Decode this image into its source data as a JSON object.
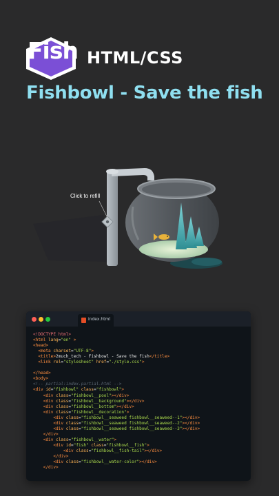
{
  "header": {
    "logo_text": "Fish",
    "logo_subtitle": "HTML/CSS",
    "headline": "Fishbowl - Save the fish"
  },
  "illustration": {
    "refill_label": "Click to refill"
  },
  "editor": {
    "tab_name": "index.html",
    "lines": [
      [
        [
          "doc",
          "<!DOCTYPE html>"
        ]
      ],
      [
        [
          "tag",
          "<html "
        ],
        [
          "attr",
          "lang"
        ],
        [
          "pun",
          "="
        ],
        [
          "str",
          "\"en\""
        ],
        [
          "tag",
          " >"
        ]
      ],
      [
        [
          "tag",
          "<head>"
        ]
      ],
      [
        [
          "pun",
          "  "
        ],
        [
          "tag",
          "<meta "
        ],
        [
          "attr",
          "charset"
        ],
        [
          "pun",
          "="
        ],
        [
          "str",
          "\"UTF-8\""
        ],
        [
          "tag",
          ">"
        ]
      ],
      [
        [
          "pun",
          "  "
        ],
        [
          "tag",
          "<title>"
        ],
        [
          "pun",
          "2much_tech - Fishbowl - Save the fish"
        ],
        [
          "tag",
          "</title>"
        ]
      ],
      [
        [
          "pun",
          "  "
        ],
        [
          "tag",
          "<link "
        ],
        [
          "attr",
          "rel"
        ],
        [
          "pun",
          "="
        ],
        [
          "str",
          "\"stylesheet\""
        ],
        [
          "pun",
          " "
        ],
        [
          "attr",
          "href"
        ],
        [
          "pun",
          "="
        ],
        [
          "str",
          "\"./style.css\""
        ],
        [
          "tag",
          ">"
        ]
      ],
      [
        [
          "pun",
          ""
        ]
      ],
      [
        [
          "tag",
          "</head>"
        ]
      ],
      [
        [
          "tag",
          "<body>"
        ]
      ],
      [
        [
          "cmt",
          "<!-- partial:index.partial.html -->"
        ]
      ],
      [
        [
          "tag",
          "<div "
        ],
        [
          "attr",
          "id"
        ],
        [
          "pun",
          "="
        ],
        [
          "str",
          "\"fishbowl\""
        ],
        [
          "pun",
          " "
        ],
        [
          "attr",
          "class"
        ],
        [
          "pun",
          "="
        ],
        [
          "str",
          "\"fishbowl\""
        ],
        [
          "tag",
          ">"
        ]
      ],
      [
        [
          "pun",
          "    "
        ],
        [
          "tag",
          "<div "
        ],
        [
          "attr",
          "class"
        ],
        [
          "pun",
          "="
        ],
        [
          "str",
          "\"fishbowl__pool\""
        ],
        [
          "tag",
          "></div>"
        ]
      ],
      [
        [
          "pun",
          "    "
        ],
        [
          "tag",
          "<div "
        ],
        [
          "attr",
          "class"
        ],
        [
          "pun",
          "="
        ],
        [
          "str",
          "\"fishbowl__background\""
        ],
        [
          "tag",
          "></div>"
        ]
      ],
      [
        [
          "pun",
          "    "
        ],
        [
          "tag",
          "<div "
        ],
        [
          "attr",
          "class"
        ],
        [
          "pun",
          "="
        ],
        [
          "str",
          "\"fishbowl__bottom\""
        ],
        [
          "tag",
          "></div>"
        ]
      ],
      [
        [
          "pun",
          "    "
        ],
        [
          "tag",
          "<div "
        ],
        [
          "attr",
          "class"
        ],
        [
          "pun",
          "="
        ],
        [
          "str",
          "\"fishbowl__decoration\""
        ],
        [
          "tag",
          ">"
        ]
      ],
      [
        [
          "pun",
          "        "
        ],
        [
          "tag",
          "<div "
        ],
        [
          "attr",
          "class"
        ],
        [
          "pun",
          "="
        ],
        [
          "str",
          "\"fishbowl__seaweed fishbowl__seaweed--1\""
        ],
        [
          "tag",
          "></div>"
        ]
      ],
      [
        [
          "pun",
          "        "
        ],
        [
          "tag",
          "<div "
        ],
        [
          "attr",
          "class"
        ],
        [
          "pun",
          "="
        ],
        [
          "str",
          "\"fishbowl__seaweed fishbowl__seaweed--2\""
        ],
        [
          "tag",
          "></div>"
        ]
      ],
      [
        [
          "pun",
          "        "
        ],
        [
          "tag",
          "<div "
        ],
        [
          "attr",
          "class"
        ],
        [
          "pun",
          "="
        ],
        [
          "str",
          "\"fishbowl__seaweed fishbowl__seaweed--3\""
        ],
        [
          "tag",
          "></div>"
        ]
      ],
      [
        [
          "pun",
          "    "
        ],
        [
          "tag",
          "</div>"
        ]
      ],
      [
        [
          "pun",
          "    "
        ],
        [
          "tag",
          "<div "
        ],
        [
          "attr",
          "class"
        ],
        [
          "pun",
          "="
        ],
        [
          "str",
          "\"fishbowl__water\""
        ],
        [
          "tag",
          ">"
        ]
      ],
      [
        [
          "pun",
          "        "
        ],
        [
          "tag",
          "<div "
        ],
        [
          "attr",
          "id"
        ],
        [
          "pun",
          "="
        ],
        [
          "str",
          "\"fish\""
        ],
        [
          "pun",
          " "
        ],
        [
          "attr",
          "class"
        ],
        [
          "pun",
          "="
        ],
        [
          "str",
          "\"fishbowl__fish\""
        ],
        [
          "tag",
          ">"
        ]
      ],
      [
        [
          "pun",
          "            "
        ],
        [
          "tag",
          "<div "
        ],
        [
          "attr",
          "class"
        ],
        [
          "pun",
          "="
        ],
        [
          "str",
          "\"fishbowl__fish-tail\""
        ],
        [
          "tag",
          "></div>"
        ]
      ],
      [
        [
          "pun",
          "        "
        ],
        [
          "tag",
          "</div>"
        ]
      ],
      [
        [
          "pun",
          "        "
        ],
        [
          "tag",
          "<div "
        ],
        [
          "attr",
          "class"
        ],
        [
          "pun",
          "="
        ],
        [
          "str",
          "\"fishbowl__water-color\""
        ],
        [
          "tag",
          "></div>"
        ]
      ],
      [
        [
          "pun",
          "    "
        ],
        [
          "tag",
          "</div>"
        ]
      ]
    ]
  },
  "colors": {
    "background": "#2a2a2b",
    "logo_hex": "#7b4fd6",
    "headline": "#8fdff0",
    "editor_bg": "#0f1419"
  }
}
